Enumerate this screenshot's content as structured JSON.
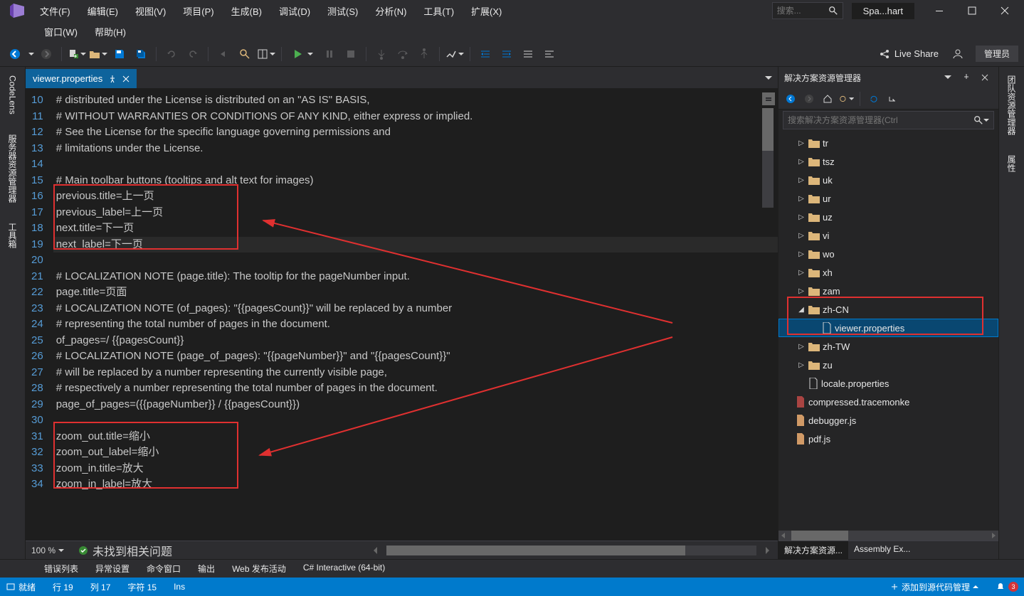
{
  "menu": {
    "file": "文件(F)",
    "edit": "编辑(E)",
    "view": "视图(V)",
    "project": "项目(P)",
    "build": "生成(B)",
    "debug": "调试(D)",
    "test": "测试(S)",
    "analyze": "分析(N)",
    "tools": "工具(T)",
    "extensions": "扩展(X)",
    "window": "窗口(W)",
    "help": "帮助(H)"
  },
  "titlebar": {
    "search_ph": "搜索...",
    "solution": "Spa...hart"
  },
  "toolbar": {
    "live_share": "Live Share",
    "admin": "管理员"
  },
  "tab": {
    "filename": "viewer.properties"
  },
  "code": {
    "lines": [
      "# distributed under the License is distributed on an \"AS IS\" BASIS,",
      "# WITHOUT WARRANTIES OR CONDITIONS OF ANY KIND, either express or implied.",
      "# See the License for the specific language governing permissions and",
      "# limitations under the License.",
      "",
      "# Main toolbar buttons (tooltips and alt text for images)",
      "previous.title=上一页",
      "previous_label=上一页",
      "next.title=下一页",
      "next_label=下一页",
      "",
      "# LOCALIZATION NOTE (page.title): The tooltip for the pageNumber input.",
      "page.title=页面",
      "# LOCALIZATION NOTE (of_pages): \"{{pagesCount}}\" will be replaced by a number",
      "# representing the total number of pages in the document.",
      "of_pages=/ {{pagesCount}}",
      "# LOCALIZATION NOTE (page_of_pages): \"{{pageNumber}}\" and \"{{pagesCount}}\"",
      "# will be replaced by a number representing the currently visible page,",
      "# respectively a number representing the total number of pages in the document.",
      "page_of_pages=({{pageNumber}} / {{pagesCount}})",
      "",
      "zoom_out.title=缩小",
      "zoom_out_label=缩小",
      "zoom_in.title=放大",
      "zoom_in_label=放大"
    ],
    "first": 10
  },
  "editor_footer": {
    "zoom": "100 %",
    "health": "未找到相关问题"
  },
  "solution_panel": {
    "title": "解决方案资源管理器",
    "search_ph": "搜索解决方案资源管理器(Ctrl",
    "folders": [
      "tr",
      "tsz",
      "uk",
      "ur",
      "uz",
      "vi",
      "wo",
      "xh",
      "zam"
    ],
    "zhcn": "zh-CN",
    "zhcn_file": "viewer.properties",
    "after": [
      "zh-TW",
      "zu"
    ],
    "files": [
      "locale.properties",
      "compressed.tracemonke",
      "debugger.js",
      "pdf.js"
    ],
    "tab_a": "解决方案资源...",
    "tab_b": "Assembly Ex..."
  },
  "left_tabs": {
    "codelens": "CodeLens",
    "server": "服务器资源管理器",
    "toolbox": "工具箱"
  },
  "right_tabs": {
    "team": "团队资源管理器",
    "props": "属性"
  },
  "bottom_tabs": {
    "errors": "错误列表",
    "exceptions": "异常设置",
    "command": "命令窗口",
    "output": "输出",
    "webpub": "Web 发布活动",
    "csharp": "C# Interactive (64-bit)"
  },
  "status": {
    "ready": "就绪",
    "line": "行 19",
    "col": "列 17",
    "char": "字符 15",
    "ins": "Ins",
    "vcs": "添加到源代码管理",
    "notif": "3"
  }
}
